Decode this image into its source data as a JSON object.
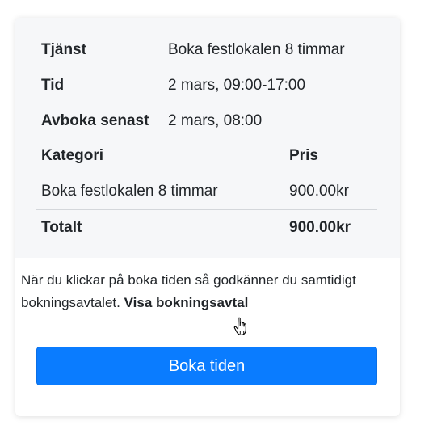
{
  "summary": {
    "service_label": "Tjänst",
    "service_value": "Boka festlokalen 8 timmar",
    "time_label": "Tid",
    "time_value": "2 mars, 09:00-17:00",
    "cancel_label": "Avboka senast",
    "cancel_value": "2 mars, 08:00",
    "category_header": "Kategori",
    "price_header": "Pris",
    "items": [
      {
        "category": "Boka festlokalen 8 timmar",
        "price": "900.00kr"
      }
    ],
    "total_label": "Totalt",
    "total_value": "900.00kr"
  },
  "terms": {
    "text": "När du klickar på boka tiden så godkänner du samtidigt bokningsavtalet.",
    "link": "Visa bokningsavtal"
  },
  "book_button": "Boka tiden",
  "icons": {
    "cursor": "hand-pointer-cursor-icon"
  },
  "colors": {
    "primary": "#0a7cff",
    "summary_bg": "#f6f7f9"
  }
}
